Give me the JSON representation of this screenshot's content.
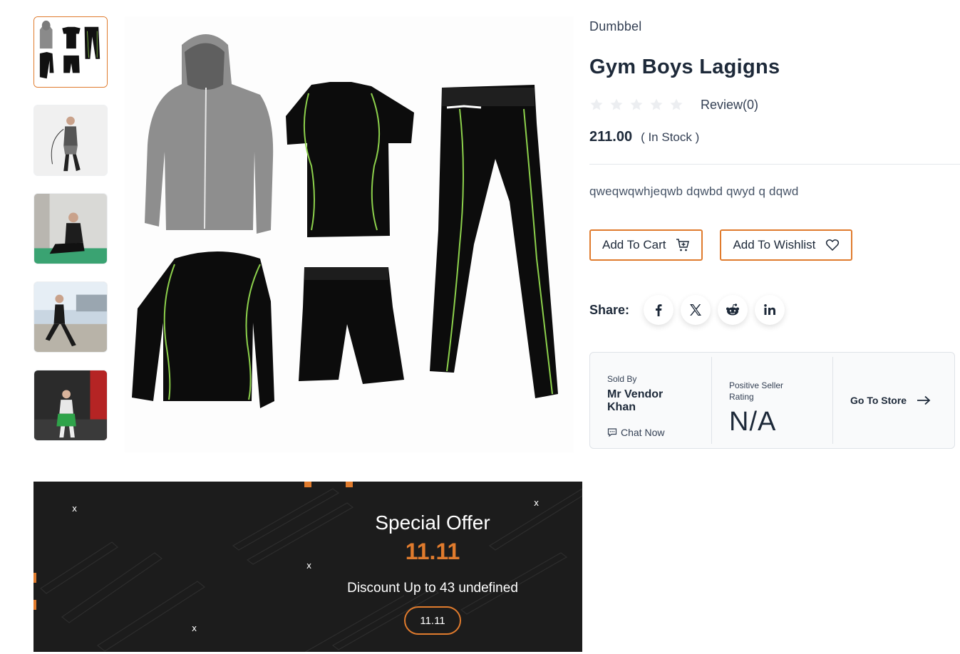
{
  "gallery": {
    "thumbnails": [
      {
        "icon": "product-set-thumbnail",
        "active": true
      },
      {
        "icon": "jump-rope-photo-thumbnail",
        "active": false
      },
      {
        "icon": "sitting-man-photo-thumbnail",
        "active": false
      },
      {
        "icon": "stretching-outdoors-photo-thumbnail",
        "active": false
      },
      {
        "icon": "gym-woman-photo-thumbnail",
        "active": false
      }
    ],
    "main_image_icon": "gym-clothing-set-image"
  },
  "product": {
    "brand": "Dumbbel",
    "title": "Gym Boys Lagigns",
    "review_text": "Review(0)",
    "rating_stars": 0,
    "rating_max": 5,
    "price": "211.00",
    "stock": "( In Stock )",
    "description": "qweqwqwhjeqwb dqwbd qwyd q dqwd"
  },
  "actions": {
    "add_to_cart": "Add To Cart",
    "add_to_wishlist": "Add To Wishlist"
  },
  "share": {
    "label": "Share:",
    "networks": [
      "facebook-icon",
      "x-icon",
      "reddit-icon",
      "linkedin-icon"
    ]
  },
  "seller": {
    "sold_by_label": "Sold By",
    "vendor_name": "Mr Vendor Khan",
    "chat_label": "Chat Now",
    "rating_label": "Positive Seller Rating",
    "rating_value": "N/A",
    "store_link": "Go To Store"
  },
  "banner": {
    "title": "Special Offer",
    "number": "11.11",
    "discount": "Discount Up to 43 undefined",
    "button": "11.11"
  },
  "colors": {
    "accent": "#e07b2d",
    "text_dark": "#1d2939",
    "banner_bg": "#1c1c1c"
  }
}
